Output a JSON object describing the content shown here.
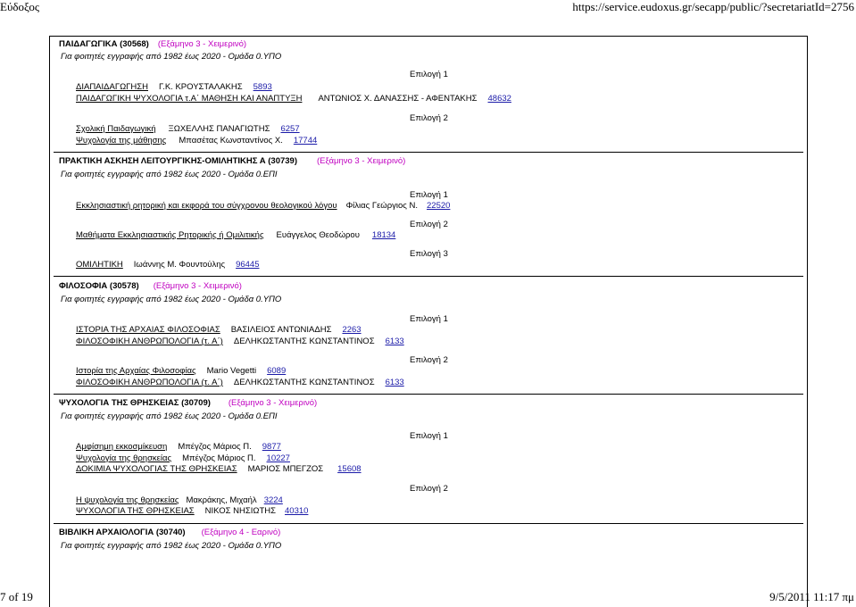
{
  "header": {
    "left": "Εύδοξος",
    "right": "https://service.eudoxus.gr/secapp/public/?secretariatId=2756"
  },
  "footer": {
    "page": "7 of 19",
    "datetime": "9/5/2011 11:17 πμ"
  },
  "courses": [
    {
      "title": "ΠΑΙΔΑΓΩΓΙΚΑ (30568)",
      "semester": "(Εξάμηνο 3 - Χειμερινό)",
      "note": "Για φοιτητές εγγραφής από 1982 έως 2020 - Ομάδα 0.ΥΠΟ",
      "options": [
        {
          "label": "Επιλογή 1",
          "books": [
            {
              "title": "ΔΙΑΠΑΙΔΑΓΩΓΗΣΗ",
              "author": "Γ.Κ. ΚΡΟΥΣΤΑΛΑΚΗΣ",
              "code": "5893"
            },
            {
              "title": "ΠΑΙΔΑΓΩΓΙΚΗ ΨΥΧΟΛΟΓΙΑ τ.Α΄ ΜΑΘΗΣΗ ΚΑΙ ΑΝΑΠΤΥΞΗ",
              "author": "ΑΝΤΩΝΙΟΣ Χ. ΔΑΝΑΣΣΗΣ - ΑΦΕΝΤΑΚΗΣ",
              "code": "48632"
            }
          ]
        },
        {
          "label": "Επιλογή 2",
          "books": [
            {
              "title": "Σχολική Παιδαγωγική",
              "author": "ΞΩΧΕΛΛΗΣ ΠΑΝΑΓΙΩΤΗΣ",
              "code": "6257"
            },
            {
              "title": "Ψυχολογία της μάθησης",
              "author": "Μπασέτας Κωνσταντίνος Χ.",
              "code": "17744"
            }
          ]
        }
      ]
    },
    {
      "title": "ΠΡΑΚΤΙΚΗ ΑΣΚΗΣΗ ΛΕΙΤΟΥΡΓΙΚΗΣ-ΟΜΙΛΗΤΙΚΗΣ Α (30739)",
      "semester": "(Εξάμηνο 3 - Χειμερινό)",
      "note": "Για φοιτητές εγγραφής από 1982 έως 2020 - Ομάδα 0.ΕΠΙ",
      "options": [
        {
          "label": "Επιλογή 1",
          "books": [
            {
              "title": "Εκκλησιαστική ρητορική και εκφορά του σύγχρονου θεολογικού λόγου",
              "author": "Φίλιας Γεώργιος Ν.",
              "code": "22520"
            }
          ]
        },
        {
          "label": "Επιλογή 2",
          "books": [
            {
              "title": "Μαθήματα Εκκλησιαστικής Ρητορικής ή Ομιλιτικής",
              "author": "Ευάγγελος Θεοδώρου",
              "code": "18134"
            }
          ]
        },
        {
          "label": "Επιλογή 3",
          "books": [
            {
              "title": "ΟΜΙΛΗΤΙΚΗ",
              "author": "Ιωάννης Μ. Φουντούλης",
              "code": "96445"
            }
          ]
        }
      ]
    },
    {
      "title": "ΦΙΛΟΣΟΦΙΑ (30578)",
      "semester": "(Εξάμηνο 3 - Χειμερινό)",
      "note": "Για φοιτητές εγγραφής από 1982 έως 2020 - Ομάδα 0.ΥΠΟ",
      "options": [
        {
          "label": "Επιλογή 1",
          "books": [
            {
              "title": "ΙΣΤΟΡΙΑ ΤΗΣ ΑΡΧΑΙΑΣ ΦΙΛΟΣΟΦΙΑΣ",
              "author": "ΒΑΣΙΛΕΙΟΣ ΑΝΤΩΝΙΑΔΗΣ",
              "code": "2263"
            },
            {
              "title": "ΦΙΛΟΣΟΦΙΚΗ ΑΝΘΡΩΠΟΛΟΓΙΑ (τ. Α΄)",
              "author": "ΔΕΛΗΚΩΣΤΑΝΤΗΣ ΚΩΝΣΤΑΝΤΙΝΟΣ",
              "code": "6133"
            }
          ]
        },
        {
          "label": "Επιλογή 2",
          "books": [
            {
              "title": "Ιστορία της Αρχαίας Φιλοσοφίας",
              "author": "Mario Vegetti",
              "code": "6089"
            },
            {
              "title": "ΦΙΛΟΣΟΦΙΚΗ ΑΝΘΡΩΠΟΛΟΓΙΑ (τ. Α΄)",
              "author": "ΔΕΛΗΚΩΣΤΑΝΤΗΣ ΚΩΝΣΤΑΝΤΙΝΟΣ",
              "code": "6133"
            }
          ]
        }
      ]
    },
    {
      "title": "ΨΥΧΟΛΟΓΙΑ ΤΗΣ ΘΡΗΣΚΕΙΑΣ (30709)",
      "semester": "(Εξάμηνο 3 - Χειμερινό)",
      "note": "Για φοιτητές εγγραφής από 1982 έως 2020 - Ομάδα 0.ΕΠΙ",
      "options": [
        {
          "label": "Επιλογή 1",
          "books": [
            {
              "title": "Αμφίσημη εκκοσμίκευση",
              "author": "Μπέγζος Μάριος Π.",
              "code": "9877"
            },
            {
              "title": "Ψυχολογία της θρησκείας",
              "author": "Μπέγζος Μάριος Π.",
              "code": "10227"
            },
            {
              "title": "ΔΟΚΙΜΙΑ ΨΥΧΟΛΟΓΙΑΣ ΤΗΣ ΘΡΗΣΚΕΙΑΣ",
              "author": "ΜΑΡΙΟΣ ΜΠΕΓΖΟΣ",
              "code": "15608"
            }
          ]
        },
        {
          "label": "Επιλογή 2",
          "books": [
            {
              "title": "Η ψυχολογία της θρησκείας",
              "author": "Μακράκης, Μιχαήλ",
              "code": "3224"
            },
            {
              "title": "ΨΥΧΟΛΟΓΙΑ ΤΗΣ ΘΡΗΣΚΕΙΑΣ",
              "author": "ΝΙΚΟΣ ΝΗΣΙΩΤΗΣ",
              "code": "40310"
            }
          ]
        }
      ]
    },
    {
      "title": "ΒΙΒΛΙΚΗ ΑΡΧΑΙΟΛΟΓΙΑ (30740)",
      "semester": "(Εξάμηνο 4 - Εαρινό)",
      "note": "Για φοιτητές εγγραφής από 1982 έως 2020 - Ομάδα 0.ΥΠΟ",
      "options": []
    }
  ]
}
